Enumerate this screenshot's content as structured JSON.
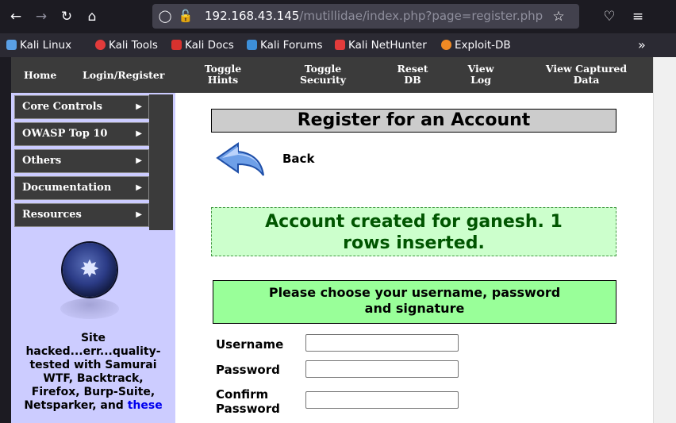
{
  "browser": {
    "url_host": "192.168.43.145",
    "url_path": "/mutillidae/index.php?page=register.php",
    "bookmarks": [
      "Kali Linux",
      "Kali Tools",
      "Kali Docs",
      "Kali Forums",
      "Kali NetHunter",
      "Exploit-DB"
    ],
    "overflow": "»"
  },
  "topnav": {
    "home": "Home",
    "login": "Login/Register",
    "hints_1": "Toggle",
    "hints_2": "Hints",
    "security_1": "Toggle",
    "security_2": "Security",
    "reset_1": "Reset",
    "reset_2": "DB",
    "log_1": "View",
    "log_2": "Log",
    "captured_1": "View Captured",
    "captured_2": "Data"
  },
  "sidebar": {
    "items": [
      "Core Controls",
      "OWASP Top 10",
      "Others",
      "Documentation",
      "Resources"
    ],
    "text_1": "Site",
    "text_2": "hacked...err...quality-",
    "text_3": "tested with Samurai",
    "text_4": "WTF, Backtrack,",
    "text_5": "Firefox, Burp-Suite,",
    "text_6a": "Netsparker, and ",
    "text_6b": "these"
  },
  "main": {
    "title": "Register for an Account",
    "back": "Back",
    "success_1": "Account created for ganesh. 1",
    "success_2": "rows inserted.",
    "choose_1": "Please choose your username, password",
    "choose_2": "and signature",
    "username_label": "Username",
    "password_label": "Password",
    "confirm_label_1": "Confirm",
    "confirm_label_2": "Password"
  }
}
